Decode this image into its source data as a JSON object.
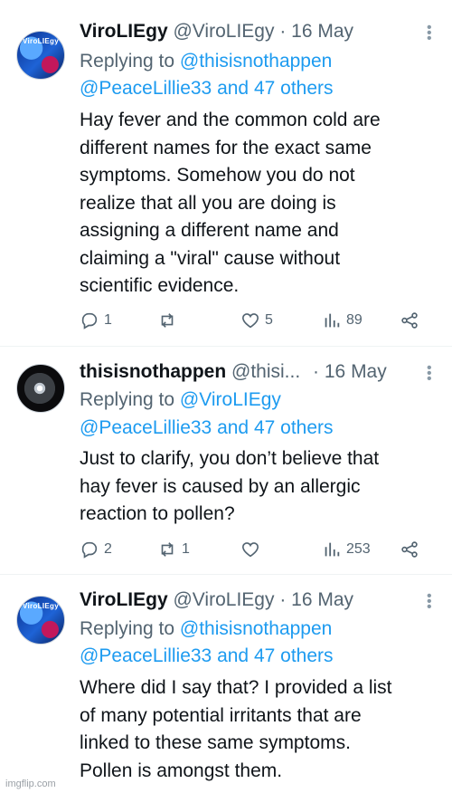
{
  "tweets": [
    {
      "name": "ViroLIEgy",
      "handle": "@ViroLIEgy",
      "dot": "·",
      "date": "16 May",
      "replying_prefix": "Replying to",
      "reply_to_1": "@thisisnothappen",
      "reply_to_2": "@PeaceLillie33 and 47 others",
      "avatar_text": "ViroLIEgy",
      "lines": [
        "Hay fever and the common cold are",
        "different names for the exact same",
        "symptoms. Somehow you do not",
        "realize that all you are doing is",
        "assigning a different name and",
        "claiming a \"viral\" cause without",
        "scientific evidence."
      ],
      "replies": "1",
      "retweets": "",
      "likes": "5",
      "views": "89"
    },
    {
      "name": "thisisnothappen",
      "handle": "@thisi...",
      "dot": "·",
      "date": "16 May",
      "replying_prefix": "Replying to",
      "reply_to_1": "@ViroLIEgy",
      "reply_to_2": "@PeaceLillie33 and 47 others",
      "lines": [
        "Just to clarify, you don’t believe that",
        "hay fever is caused by an allergic",
        "reaction to pollen?"
      ],
      "replies": "2",
      "retweets": "1",
      "likes": "",
      "views": "253"
    },
    {
      "name": "ViroLIEgy",
      "handle": "@ViroLIEgy",
      "dot": "·",
      "date": "16 May",
      "replying_prefix": "Replying to",
      "reply_to_1": "@thisisnothappen",
      "reply_to_2": "@PeaceLillie33 and 47 others",
      "avatar_text": "ViroLIEgy",
      "lines": [
        "Where did I say that? I provided a list",
        "of many potential irritants that are",
        "linked to these same symptoms.",
        "Pollen is amongst them."
      ]
    }
  ],
  "watermark": "imgflip.com",
  "colors": {
    "link": "#1d9bf0",
    "muted": "#536471",
    "text": "#0f1419"
  }
}
